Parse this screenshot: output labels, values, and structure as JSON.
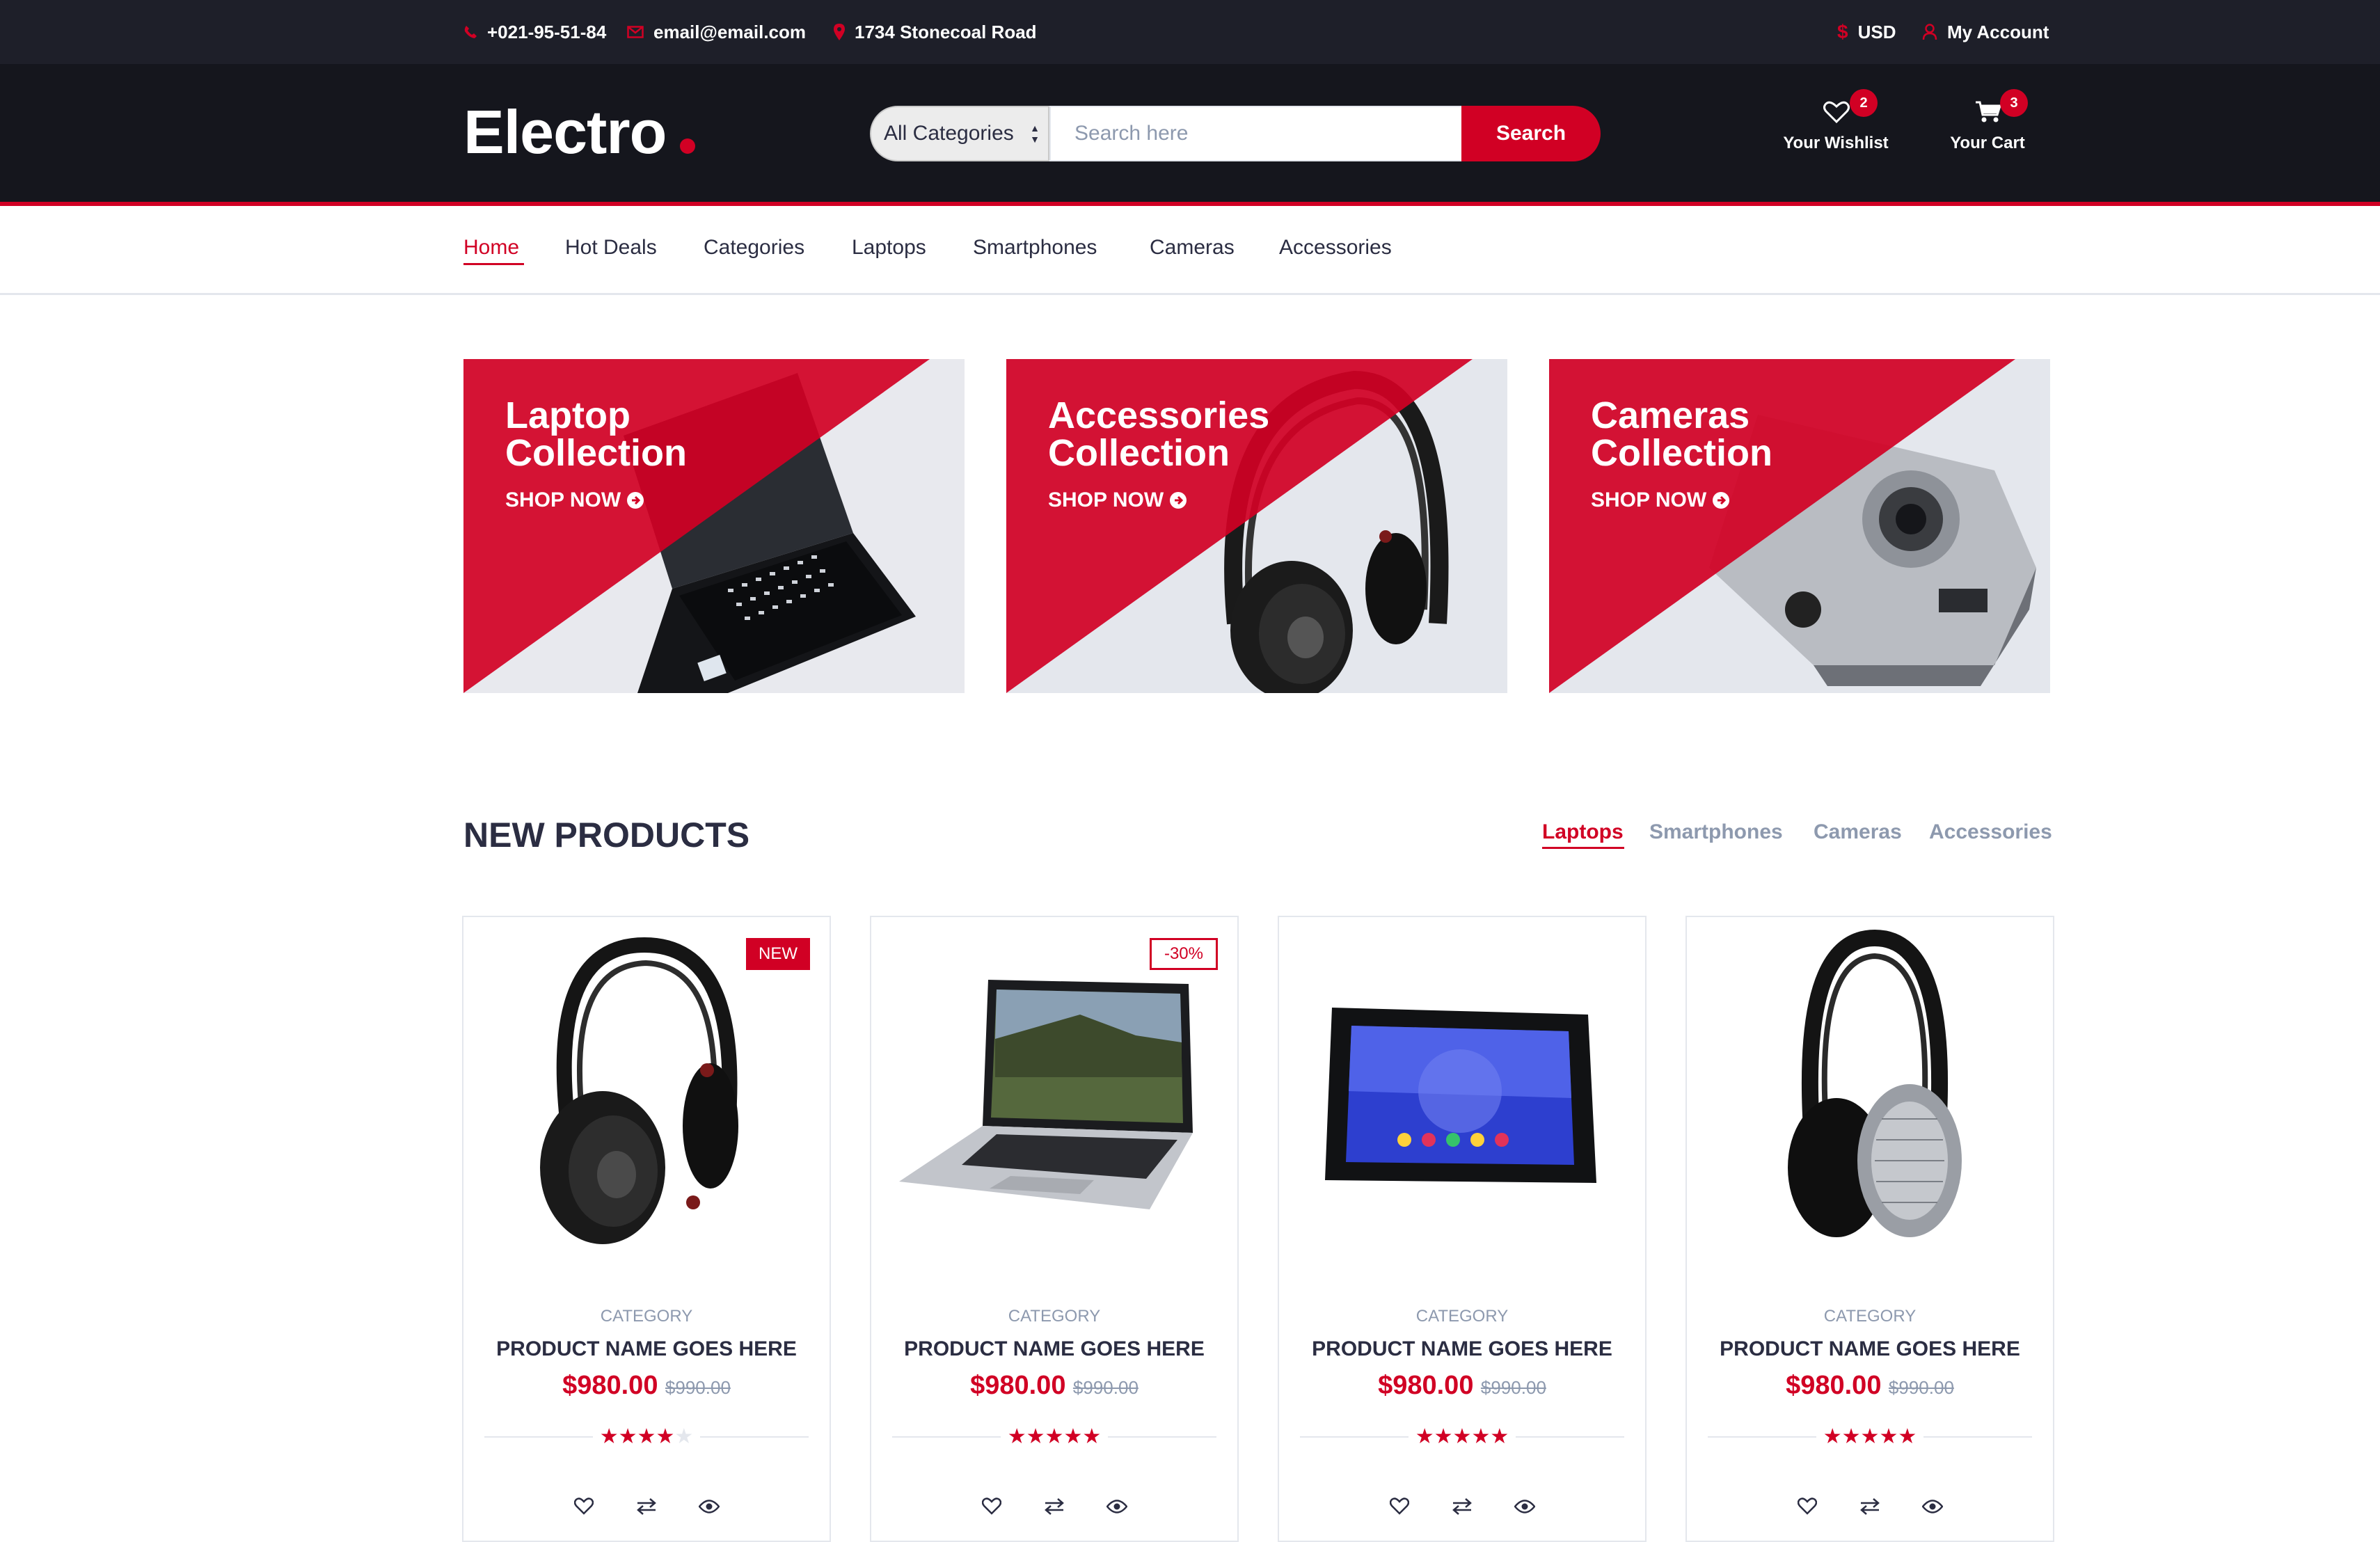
{
  "topbar": {
    "phone": "+021-95-51-84",
    "email": "email@email.com",
    "address": "1734 Stonecoal Road",
    "currency": "USD",
    "account": "My Account"
  },
  "header": {
    "logo": "Electro",
    "category_select": "All Categories",
    "search_placeholder": "Search here",
    "search_button": "Search",
    "wishlist_label": "Your Wishlist",
    "wishlist_count": "2",
    "cart_label": "Your Cart",
    "cart_count": "3"
  },
  "nav": {
    "items": [
      "Home",
      "Hot Deals",
      "Categories",
      "Laptops",
      "Smartphones",
      "Cameras",
      "Accessories"
    ],
    "active": "Home"
  },
  "collections": [
    {
      "title_line1": "Laptop",
      "title_line2": "Collection",
      "cta": "SHOP NOW",
      "image": "laptop"
    },
    {
      "title_line1": "Accessories",
      "title_line2": "Collection",
      "cta": "SHOP NOW",
      "image": "headphones"
    },
    {
      "title_line1": "Cameras",
      "title_line2": "Collection",
      "cta": "SHOP NOW",
      "image": "camera"
    }
  ],
  "new_products": {
    "title": "NEW PRODUCTS",
    "tabs": [
      "Laptops",
      "Smartphones",
      "Cameras",
      "Accessories"
    ],
    "active_tab": "Laptops",
    "items": [
      {
        "tag": "NEW",
        "category": "CATEGORY",
        "name": "PRODUCT NAME GOES HERE",
        "price": "$980.00",
        "old_price": "$990.00",
        "rating": 4,
        "image": "studio-headphones"
      },
      {
        "tag": "-30%",
        "category": "CATEGORY",
        "name": "PRODUCT NAME GOES HERE",
        "price": "$980.00",
        "old_price": "$990.00",
        "rating": 5,
        "image": "laptop"
      },
      {
        "tag": "",
        "category": "CATEGORY",
        "name": "PRODUCT NAME GOES HERE",
        "price": "$980.00",
        "old_price": "$990.00",
        "rating": 5,
        "image": "tablet"
      },
      {
        "tag": "",
        "category": "CATEGORY",
        "name": "PRODUCT NAME GOES HERE",
        "price": "$980.00",
        "old_price": "$990.00",
        "rating": 5,
        "image": "silver-headphones"
      }
    ]
  },
  "colors": {
    "accent": "#D10024",
    "topbar_bg": "#1E1F29",
    "header_bg": "#15161D",
    "text_dark": "#2B2D42",
    "text_muted": "#8D99AE",
    "border": "#E4E7ED"
  },
  "icons": {
    "phone": "phone-icon",
    "email": "envelope-icon",
    "address": "map-marker-icon",
    "currency": "dollar-icon",
    "account": "user-icon",
    "wishlist": "heart-icon",
    "cart": "shopping-cart-icon",
    "cta": "arrow-circle-right-icon",
    "product_actions": [
      "heart-icon",
      "exchange-icon",
      "eye-icon"
    ]
  }
}
